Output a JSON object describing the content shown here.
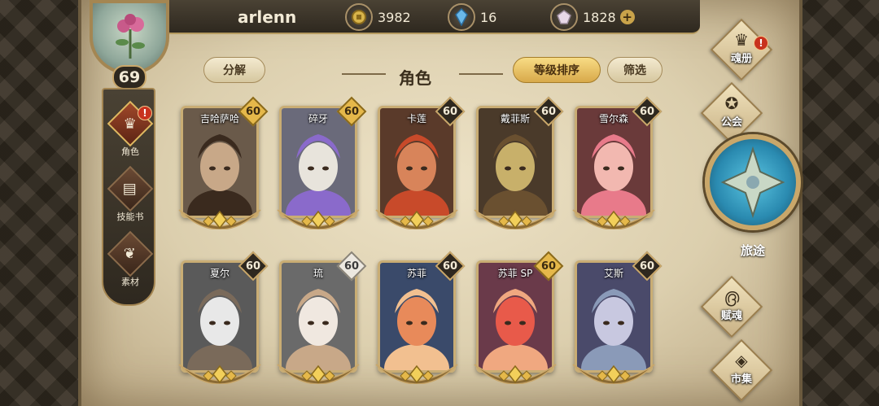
{
  "player": {
    "name": "arlenn",
    "level": "69"
  },
  "resources": [
    {
      "icon": "coin-icon",
      "value": "3982"
    },
    {
      "icon": "crystal-icon",
      "value": "16"
    },
    {
      "icon": "gem-icon",
      "value": "1828"
    }
  ],
  "side_menu": [
    {
      "label": "角色",
      "icon": "character-icon",
      "alert": "!"
    },
    {
      "label": "技能书",
      "icon": "skillbook-icon"
    },
    {
      "label": "素材",
      "icon": "material-icon"
    }
  ],
  "header": {
    "title": "角色",
    "decompose": "分解",
    "sort": "等级排序",
    "filter": "筛选"
  },
  "characters": [
    {
      "name": "吉哈萨哈",
      "level": "60",
      "badge": "gold"
    },
    {
      "name": "碎牙",
      "level": "60",
      "badge": "gold"
    },
    {
      "name": "卡莲",
      "level": "60",
      "badge": "dark"
    },
    {
      "name": "戴菲斯",
      "level": "60",
      "badge": "dark"
    },
    {
      "name": "雪尔森",
      "level": "60",
      "badge": "dark"
    },
    {
      "name": "夏尔",
      "level": "60",
      "badge": "dark"
    },
    {
      "name": "琉",
      "level": "60",
      "badge": "silver"
    },
    {
      "name": "苏菲",
      "level": "60",
      "badge": "dark"
    },
    {
      "name": "苏菲 SP",
      "level": "60",
      "badge": "gold"
    },
    {
      "name": "艾斯",
      "level": "60",
      "badge": "dark"
    }
  ],
  "right_nav": [
    {
      "label": "魂册",
      "icon": "soulbook-icon",
      "alert": "!"
    },
    {
      "label": "公会",
      "icon": "guild-icon"
    },
    {
      "label": "旅途",
      "icon": "journey-icon"
    },
    {
      "label": "赋魂",
      "icon": "ensoul-icon"
    },
    {
      "label": "市集",
      "icon": "market-icon"
    }
  ],
  "colors": {
    "gold": "#e5b84a",
    "alert": "#c8321e",
    "frame_dark": "#2e281f",
    "paper": "#e6d9ba"
  }
}
